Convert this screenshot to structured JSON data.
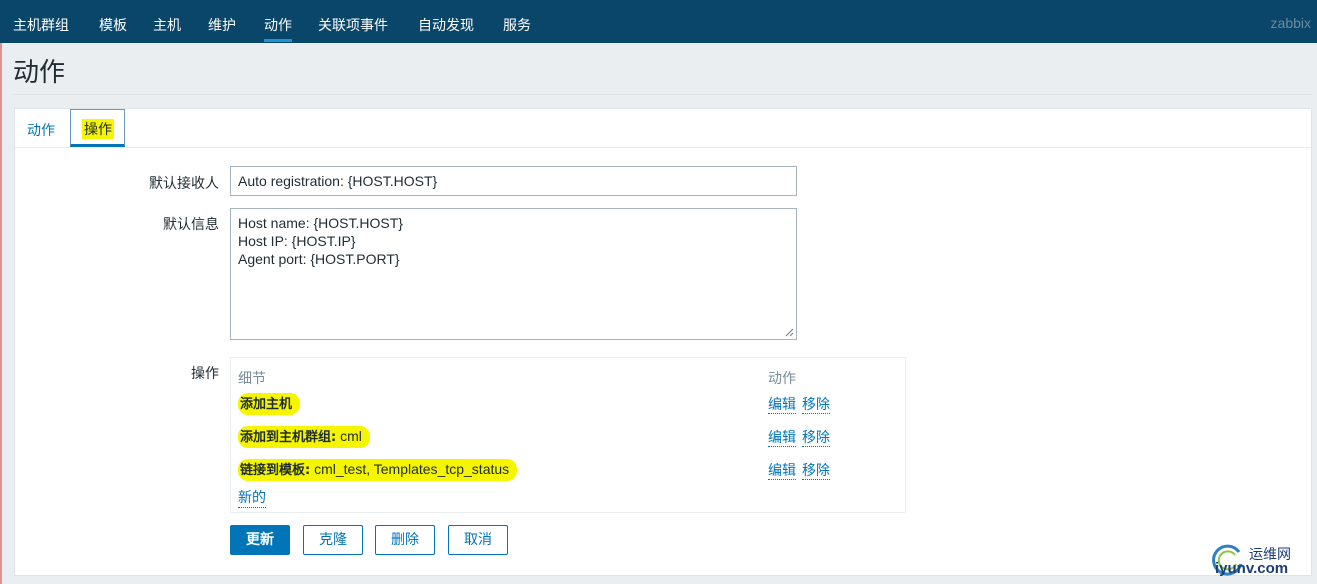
{
  "nav": {
    "items": [
      "主机群组",
      "模板",
      "主机",
      "维护",
      "动作",
      "关联项事件",
      "自动发现",
      "服务"
    ],
    "active_index": 4,
    "brand": "zabbix"
  },
  "page": {
    "title": "动作"
  },
  "tabs": [
    "动作",
    "操作"
  ],
  "form": {
    "default_recipient_label": "默认接收人",
    "default_recipient_value": "Auto registration: {HOST.HOST}",
    "default_message_label": "默认信息",
    "default_message_lines": [
      "Host name: {HOST.HOST}",
      "Host IP: {HOST.IP}",
      "Agent port: {HOST.PORT}"
    ],
    "operations_label": "操作"
  },
  "operations": {
    "col_details": "细节",
    "col_action": "动作",
    "rows": [
      {
        "bold": "添加主机",
        "rest": "",
        "edit": "编辑",
        "remove": "移除"
      },
      {
        "bold": "添加到主机群组:",
        "rest": " cml",
        "edit": "编辑",
        "remove": "移除"
      },
      {
        "bold": "链接到模板:",
        "rest": " cml_test, Templates_tcp_status",
        "edit": "编辑",
        "remove": "移除"
      }
    ],
    "new_link": "新的"
  },
  "buttons": {
    "update": "更新",
    "clone": "克隆",
    "delete": "删除",
    "cancel": "取消"
  },
  "watermark": {
    "cn": "运维网",
    "en": "iyunv.com"
  },
  "colors": {
    "nav_bg": "#0a466a",
    "accent": "#0275b8",
    "highlight": "#f5f500"
  }
}
